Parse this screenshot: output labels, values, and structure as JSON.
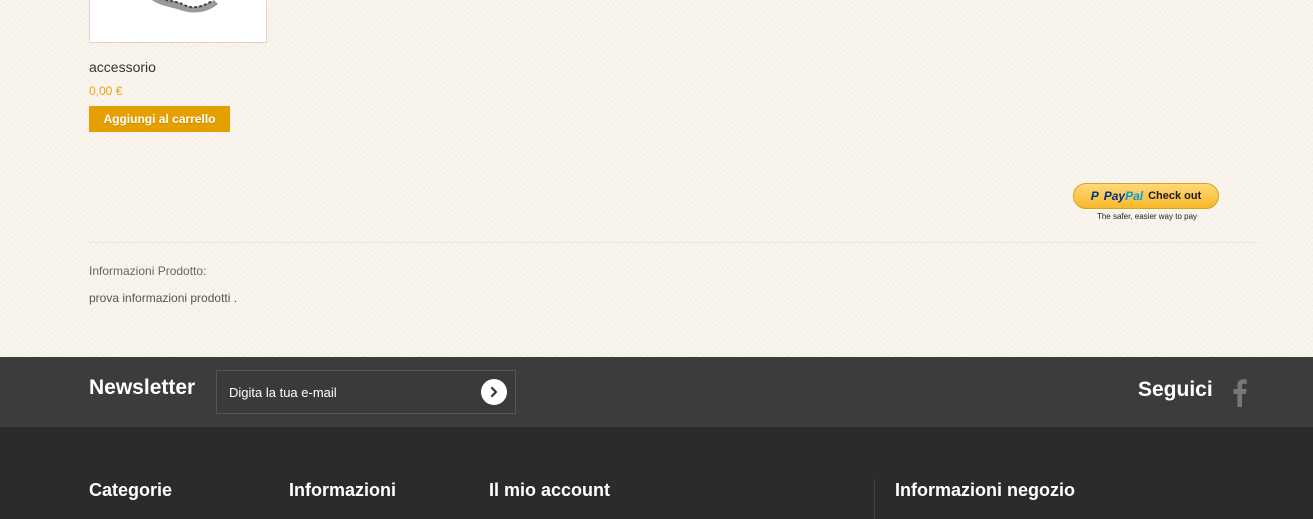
{
  "product": {
    "name": "accessorio",
    "price": "0,00 €",
    "add_to_cart_label": "Aggiungi al carrello"
  },
  "paypal": {
    "brand_pay": "Pay",
    "brand_pal": "Pal",
    "button_label": "Check out",
    "tagline": "The safer, easier way to pay"
  },
  "product_info": {
    "label": "Informazioni Prodotto:",
    "text": "prova informazioni prodotti ."
  },
  "newsletter": {
    "title": "Newsletter",
    "input_value": "",
    "input_placeholder": "Digita la tua e-mail"
  },
  "social": {
    "title": "Seguici",
    "icons": [
      "facebook-icon"
    ]
  },
  "footer": {
    "columns": [
      {
        "title": "Categorie"
      },
      {
        "title": "Informazioni"
      },
      {
        "title": "Il mio account"
      },
      {
        "title": "Informazioni negozio"
      }
    ]
  },
  "colors": {
    "accent": "#e69f00",
    "price": "#e8a218",
    "newsletter_bar": "#3c3c3c",
    "footer_bg": "#2b2b2b",
    "page_bg": "#f8f4ec"
  }
}
